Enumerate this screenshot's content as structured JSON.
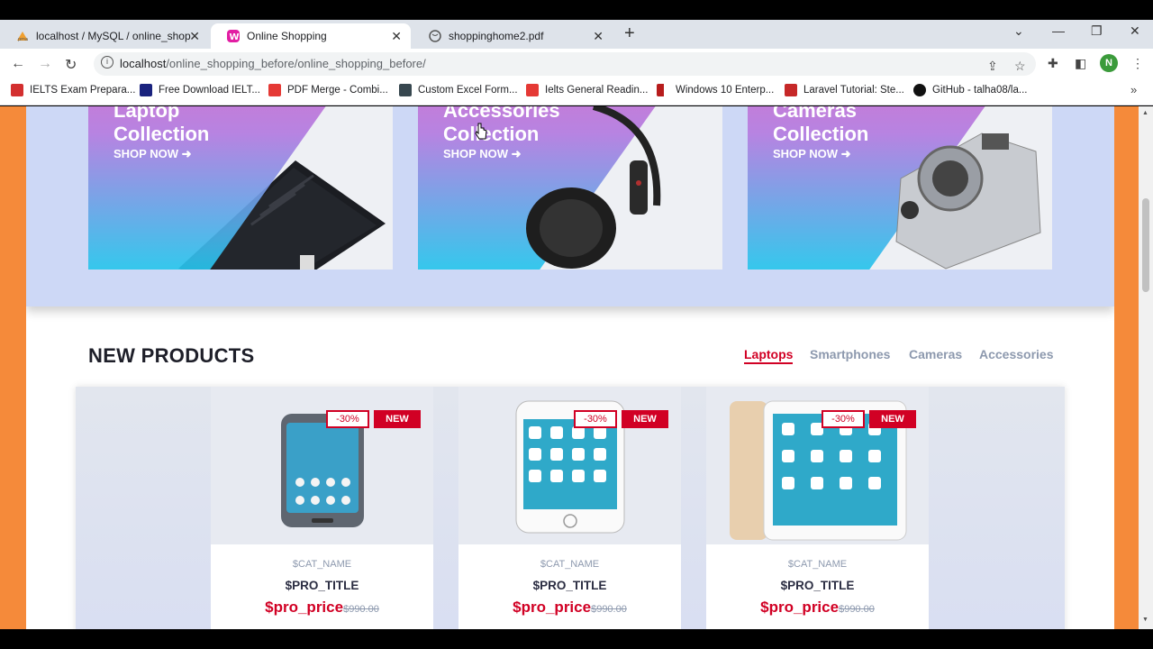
{
  "browser": {
    "tabs": [
      {
        "label": "localhost / MySQL / online_shop",
        "active": false
      },
      {
        "label": "Online Shopping",
        "active": true
      },
      {
        "label": "shoppinghome2.pdf",
        "active": false
      }
    ],
    "url_host": "localhost",
    "url_path": "/online_shopping_before/online_shopping_before/",
    "avatar_letter": "N",
    "bookmarks": [
      "IELTS Exam Prepara...",
      "Free Download IELT...",
      "PDF Merge - Combi...",
      "Custom Excel Form...",
      "Ielts General Readin...",
      "Windows 10 Enterp...",
      "Laravel Tutorial: Ste...",
      "GitHub - talha08/la..."
    ],
    "colors": {
      "accent": "#d10024",
      "bg_side": "#f58a3a"
    }
  },
  "collections": [
    {
      "title_line1": "Laptop",
      "title_line2": "Collection",
      "cta": "SHOP NOW",
      "icon": "laptop"
    },
    {
      "title_line1": "Accessories",
      "title_line2": "Collection",
      "cta": "SHOP NOW",
      "icon": "headphones"
    },
    {
      "title_line1": "Cameras",
      "title_line2": "Collection",
      "cta": "SHOP NOW",
      "icon": "camera"
    }
  ],
  "new_products": {
    "title": "NEW PRODUCTS",
    "tabs": [
      "Laptops",
      "Smartphones",
      "Cameras",
      "Accessories"
    ],
    "active_tab": "Laptops",
    "cards": [
      {
        "sale": "-30%",
        "new": "NEW",
        "cat": "$CAT_NAME",
        "title": "$PRO_TITLE",
        "price": "$pro_price",
        "old_price": "$990.00",
        "image": "galaxy-phone"
      },
      {
        "sale": "-30%",
        "new": "NEW",
        "cat": "$CAT_NAME",
        "title": "$PRO_TITLE",
        "price": "$pro_price",
        "old_price": "$990.00",
        "image": "iphone"
      },
      {
        "sale": "-30%",
        "new": "NEW",
        "cat": "$CAT_NAME",
        "title": "$PRO_TITLE",
        "price": "$pro_price",
        "old_price": "$990.00",
        "image": "ipad"
      }
    ]
  }
}
